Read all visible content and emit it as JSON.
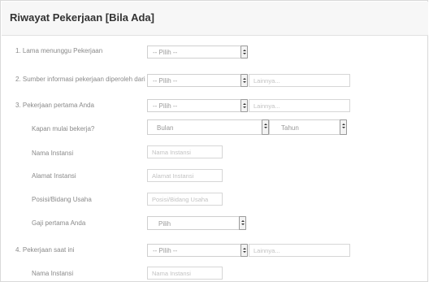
{
  "section": {
    "title": "Riwayat Pekerjaan [Bila Ada]"
  },
  "rows": {
    "r1": {
      "label": "1. Lama menunggu Pekerjaan",
      "select": "-- Pilih --"
    },
    "r2": {
      "label": "2. Sumber informasi pekerjaan diperoleh dari",
      "select": "-- Pilih --",
      "placeholder": "Lainnya..."
    },
    "r3": {
      "label": "3. Pekerjaan pertama Anda",
      "select": "-- Pilih --",
      "placeholder": "Lainnya..."
    },
    "r4": {
      "label": "Kapan mulai bekerja?",
      "select_month": "Bulan",
      "select_year": "Tahun"
    },
    "r5": {
      "label": "Nama Instansi",
      "placeholder": "Nama Instansi"
    },
    "r6": {
      "label": "Alamat Instansi",
      "placeholder": "Alamat Instansi"
    },
    "r7": {
      "label": "Posisi/Bidang Usaha",
      "placeholder": "Posisi/Bidang Usaha"
    },
    "r8": {
      "label": "Gaji pertama Anda",
      "select": "Pilih"
    },
    "r9": {
      "label": "4. Pekerjaan saat ini",
      "select": "-- Pilih --",
      "placeholder": "Lainnya..."
    },
    "r10": {
      "label": "Nama Instansi",
      "placeholder": "Nama Instansi"
    }
  }
}
